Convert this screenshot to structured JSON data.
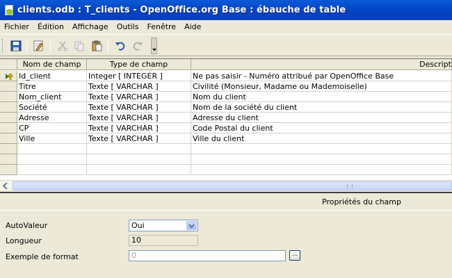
{
  "window": {
    "title": "clients.odb : T_clients - OpenOffice.org Base : ébauche de table"
  },
  "menu": [
    "Fichier",
    "Édition",
    "Affichage",
    "Outils",
    "Fenêtre",
    "Aide"
  ],
  "grid": {
    "headers": [
      "Nom de champ",
      "Type de champ",
      "Descript"
    ],
    "rows": [
      {
        "name": "Id_client",
        "type": "Integer [ INTEGER ]",
        "desc": "Ne pas saisir - Numéro attribué par OpenOffice Base"
      },
      {
        "name": "Titre",
        "type": "Texte [ VARCHAR ]",
        "desc": "Civilité (Monsieur, Madame ou Mademoiselle)"
      },
      {
        "name": "Nom_client",
        "type": "Texte [ VARCHAR ]",
        "desc": "Nom du client"
      },
      {
        "name": "Société",
        "type": "Texte [ VARCHAR ]",
        "desc": "Nom de la société du client"
      },
      {
        "name": "Adresse",
        "type": "Texte [ VARCHAR ]",
        "desc": "Adresse du client"
      },
      {
        "name": "CP",
        "type": "Texte [ VARCHAR ]",
        "desc": "Code Postal du client"
      },
      {
        "name": "Ville",
        "type": "Texte [ VARCHAR ]",
        "desc": "Ville du client"
      }
    ]
  },
  "properties": {
    "title": "Propriétés du champ",
    "autovaleur_label": "AutoValeur",
    "autovaleur_value": "Oui",
    "longueur_label": "Longueur",
    "longueur_value": "10",
    "format_label": "Exemple de format",
    "format_value": "0",
    "format_button": "..."
  },
  "colors": {
    "titlebar": "#0a5ad7",
    "selection": "#316ac5"
  }
}
